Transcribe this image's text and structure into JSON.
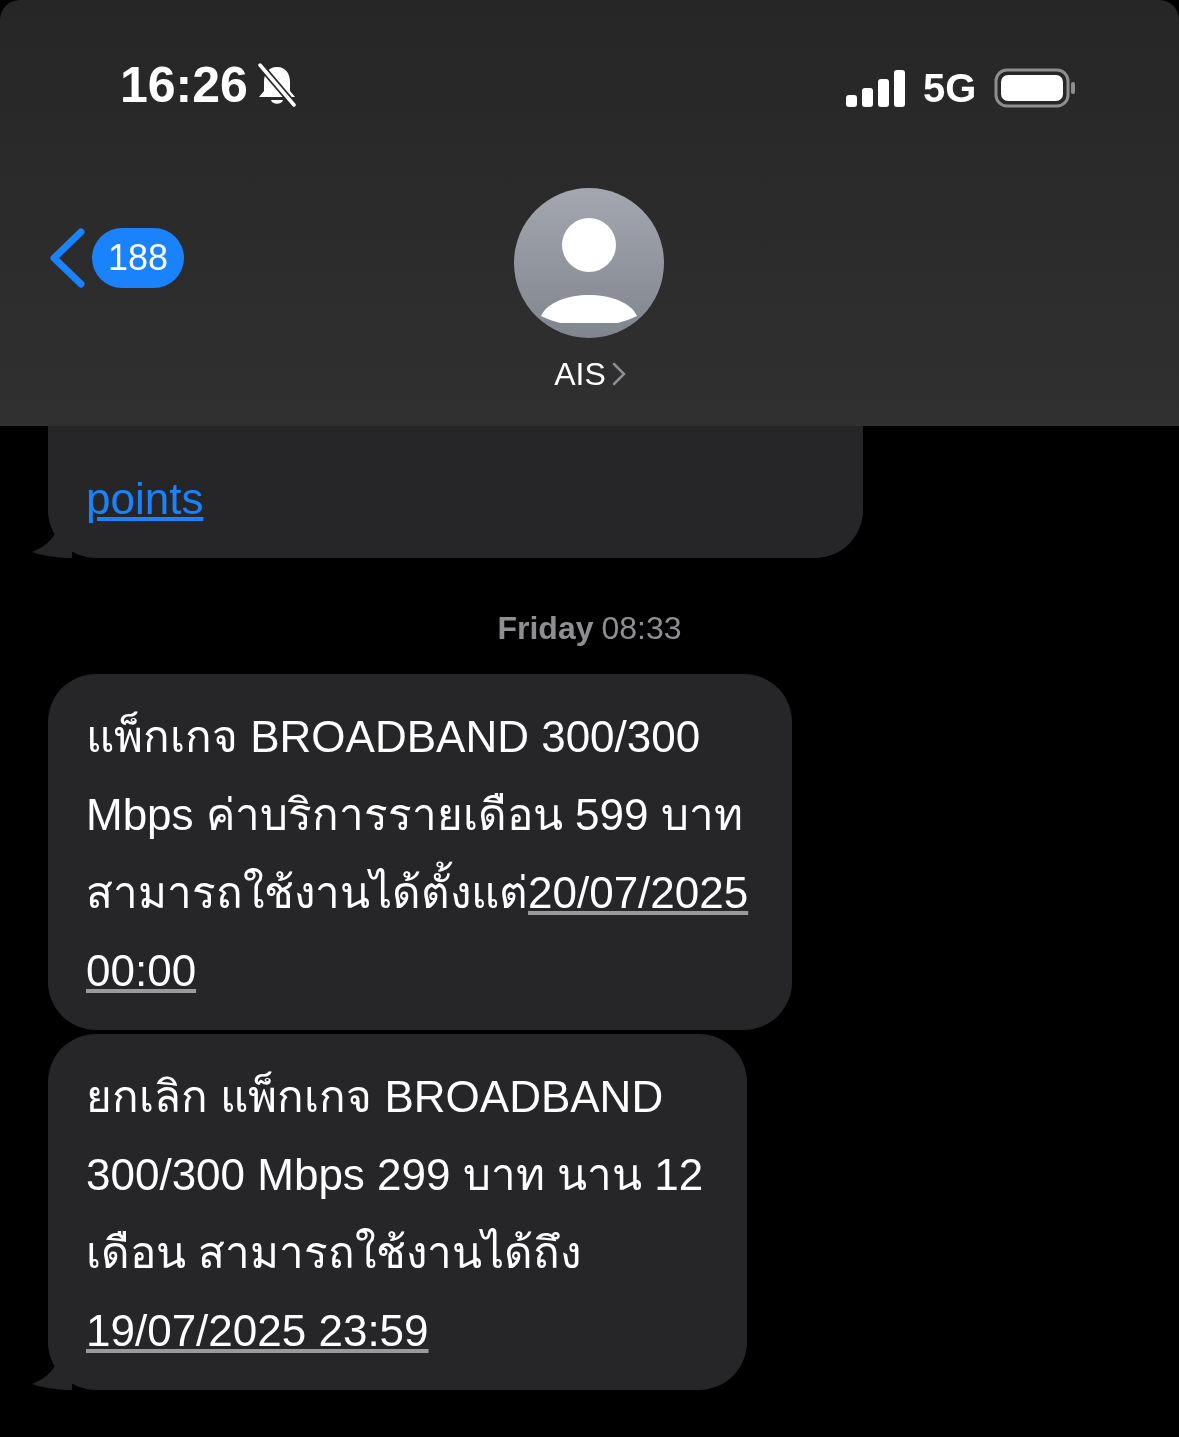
{
  "status_bar": {
    "time": "16:26",
    "silent": true,
    "network": "5G"
  },
  "header": {
    "back_count": "188",
    "contact": "AIS"
  },
  "thread": [
    {
      "kind": "bubble",
      "tail": true,
      "lines": [
        [
          {
            "kind": "link",
            "text": "points"
          }
        ]
      ]
    },
    {
      "kind": "timestamp",
      "day": "Friday",
      "time": "08:33"
    },
    {
      "kind": "bubble",
      "tail": false,
      "lines": [
        [
          {
            "kind": "text",
            "text": "แพ็กเกจ BROADBAND 300/300"
          }
        ],
        [
          {
            "kind": "text",
            "text": "Mbps ค่าบริการรายเดือน 599 บาท"
          }
        ],
        [
          {
            "kind": "text",
            "text": "สามารถใช้งานได้ตั้งแต่ "
          },
          {
            "kind": "date",
            "text": "20/07/2025"
          }
        ],
        [
          {
            "kind": "date",
            "text": "00:00"
          }
        ]
      ]
    },
    {
      "kind": "bubble",
      "tail": true,
      "lines": [
        [
          {
            "kind": "text",
            "text": "ยกเลิก แพ็กเกจ BROADBAND"
          }
        ],
        [
          {
            "kind": "text",
            "text": "300/300 Mbps 299 บาท นาน 12"
          }
        ],
        [
          {
            "kind": "text",
            "text": "เดือน สามารถใช้งานได้ถึง"
          }
        ],
        [
          {
            "kind": "date",
            "text": "19/07/2025 23:59"
          }
        ]
      ]
    }
  ]
}
